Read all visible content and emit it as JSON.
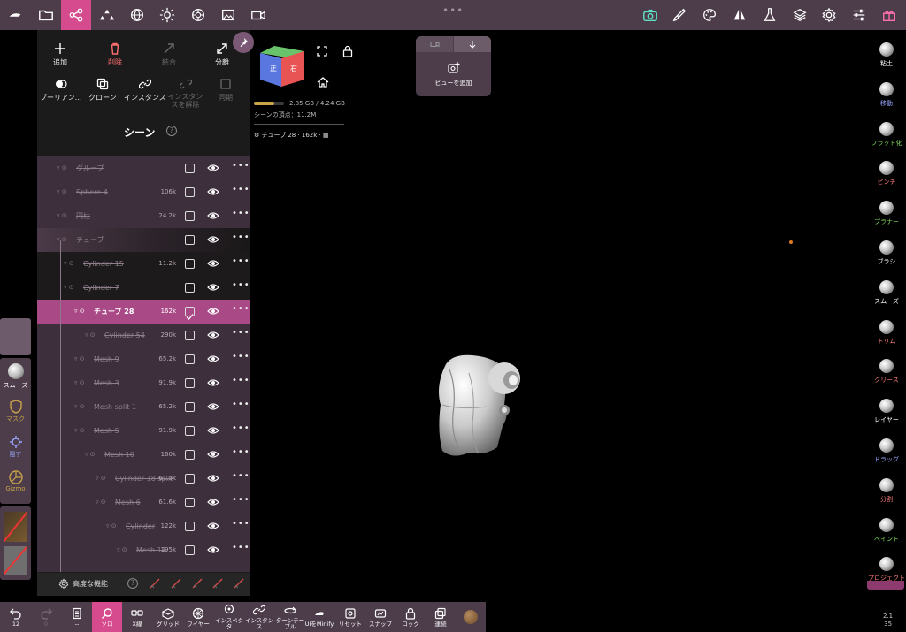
{
  "topbar": {
    "items": [
      "app-logo",
      "folder",
      "scene-graph",
      "shapes",
      "globe",
      "sun",
      "material",
      "image",
      "video"
    ],
    "right_items": [
      "camera",
      "brush",
      "palette",
      "symmetry",
      "flask",
      "layers",
      "settings",
      "sliders",
      "gift"
    ],
    "dots": "•••"
  },
  "left_panel": {
    "actions": {
      "add": "追加",
      "delete": "削除",
      "merge": "結合",
      "split": "分離",
      "boolean": "ブーリアン…",
      "clone": "クローン",
      "instance": "インスタンス",
      "uninstance": "インスタンスを解除",
      "symmetry": "同期"
    },
    "scene_title": "シーン",
    "scene_help": "?",
    "rows": [
      {
        "name": "グループ",
        "count": "",
        "depth": 0,
        "checked": false
      },
      {
        "name": "Sphere 4",
        "count": "106k",
        "depth": 0,
        "checked": false
      },
      {
        "name": "円柱",
        "count": "24.2k",
        "depth": 0,
        "checked": false
      },
      {
        "name": "チューブ",
        "count": "",
        "depth": 0,
        "checked": false
      },
      {
        "name": "Cylinder 15",
        "count": "11.2k",
        "depth": 1,
        "checked": false
      },
      {
        "name": "Cylinder 7",
        "count": "",
        "depth": 1,
        "checked": false
      },
      {
        "name": "チューブ 28",
        "count": "162k",
        "depth": 2,
        "checked": true
      },
      {
        "name": "Cylinder 54",
        "count": "290k",
        "depth": 3,
        "checked": false
      },
      {
        "name": "Mesh 9",
        "count": "65.2k",
        "depth": 2,
        "checked": false
      },
      {
        "name": "Mesh 3",
        "count": "91.9k",
        "depth": 2,
        "checked": false
      },
      {
        "name": "Mesh split 1",
        "count": "65.2k",
        "depth": 2,
        "checked": false
      },
      {
        "name": "Mesh 5",
        "count": "91.9k",
        "depth": 2,
        "checked": false
      },
      {
        "name": "Mesh 10",
        "count": "160k",
        "depth": 3,
        "checked": false
      },
      {
        "name": "Cylinder 18 split",
        "count": "61.5k",
        "depth": 4,
        "checked": false
      },
      {
        "name": "Mesh 6",
        "count": "61.6k",
        "depth": 4,
        "checked": false
      },
      {
        "name": "Cylinder",
        "count": "122k",
        "depth": 5,
        "checked": false
      },
      {
        "name": "Mesh 11",
        "count": "195k",
        "depth": 6,
        "checked": false
      }
    ],
    "advanced": "高度な機能"
  },
  "left_tools": {
    "smooth": "スムーズ",
    "mask": "マスク",
    "hide": "隠す",
    "gizmo": "Gizmo"
  },
  "viewport": {
    "cube_front": "正",
    "cube_right": "右",
    "memory": "2.85 GB / 4.24 GB",
    "memory_fraction": 0.67,
    "scene_verts": "シーンの頂点：11.2M",
    "selection": "チューブ 28 · 162k ·",
    "add_view": "ビューを追加"
  },
  "right_tools": [
    {
      "label": "粘土",
      "color": "#ffffff"
    },
    {
      "label": "移動",
      "color": "#9aa6ff"
    },
    {
      "label": "フラット化",
      "color": "#7fdc5a"
    },
    {
      "label": "ピンチ",
      "color": "#ff7f7f"
    },
    {
      "label": "プラナー",
      "color": "#7fdc5a"
    },
    {
      "label": "ブラシ",
      "color": "#ffffff"
    },
    {
      "label": "スムーズ",
      "color": "#ffffff"
    },
    {
      "label": "トリム",
      "color": "#ff7f7f"
    },
    {
      "label": "クリース",
      "color": "#ff7f7f"
    },
    {
      "label": "レイヤー",
      "color": "#ffffff"
    },
    {
      "label": "ドラッグ",
      "color": "#9aa6ff"
    },
    {
      "label": "分割",
      "color": "#ff7f7f"
    },
    {
      "label": "ペイント",
      "color": "#7fdc5a"
    },
    {
      "label": "プロジェクト",
      "color": "#ff7f7f"
    }
  ],
  "version": "2.1\n35",
  "bottombar": {
    "undo": "12",
    "redo": "0",
    "menu": "--",
    "solo": "ソロ",
    "xray": "X線",
    "grid": "グリッド",
    "wire": "ワイヤー",
    "inspector": "インスペクタ",
    "instance": "インスタンス",
    "turntable": "ターンテーブル",
    "uiminify": "UIをMinify",
    "reset": "リセット",
    "snap": "スナップ",
    "lock": "ロック",
    "continuous": "連続"
  }
}
